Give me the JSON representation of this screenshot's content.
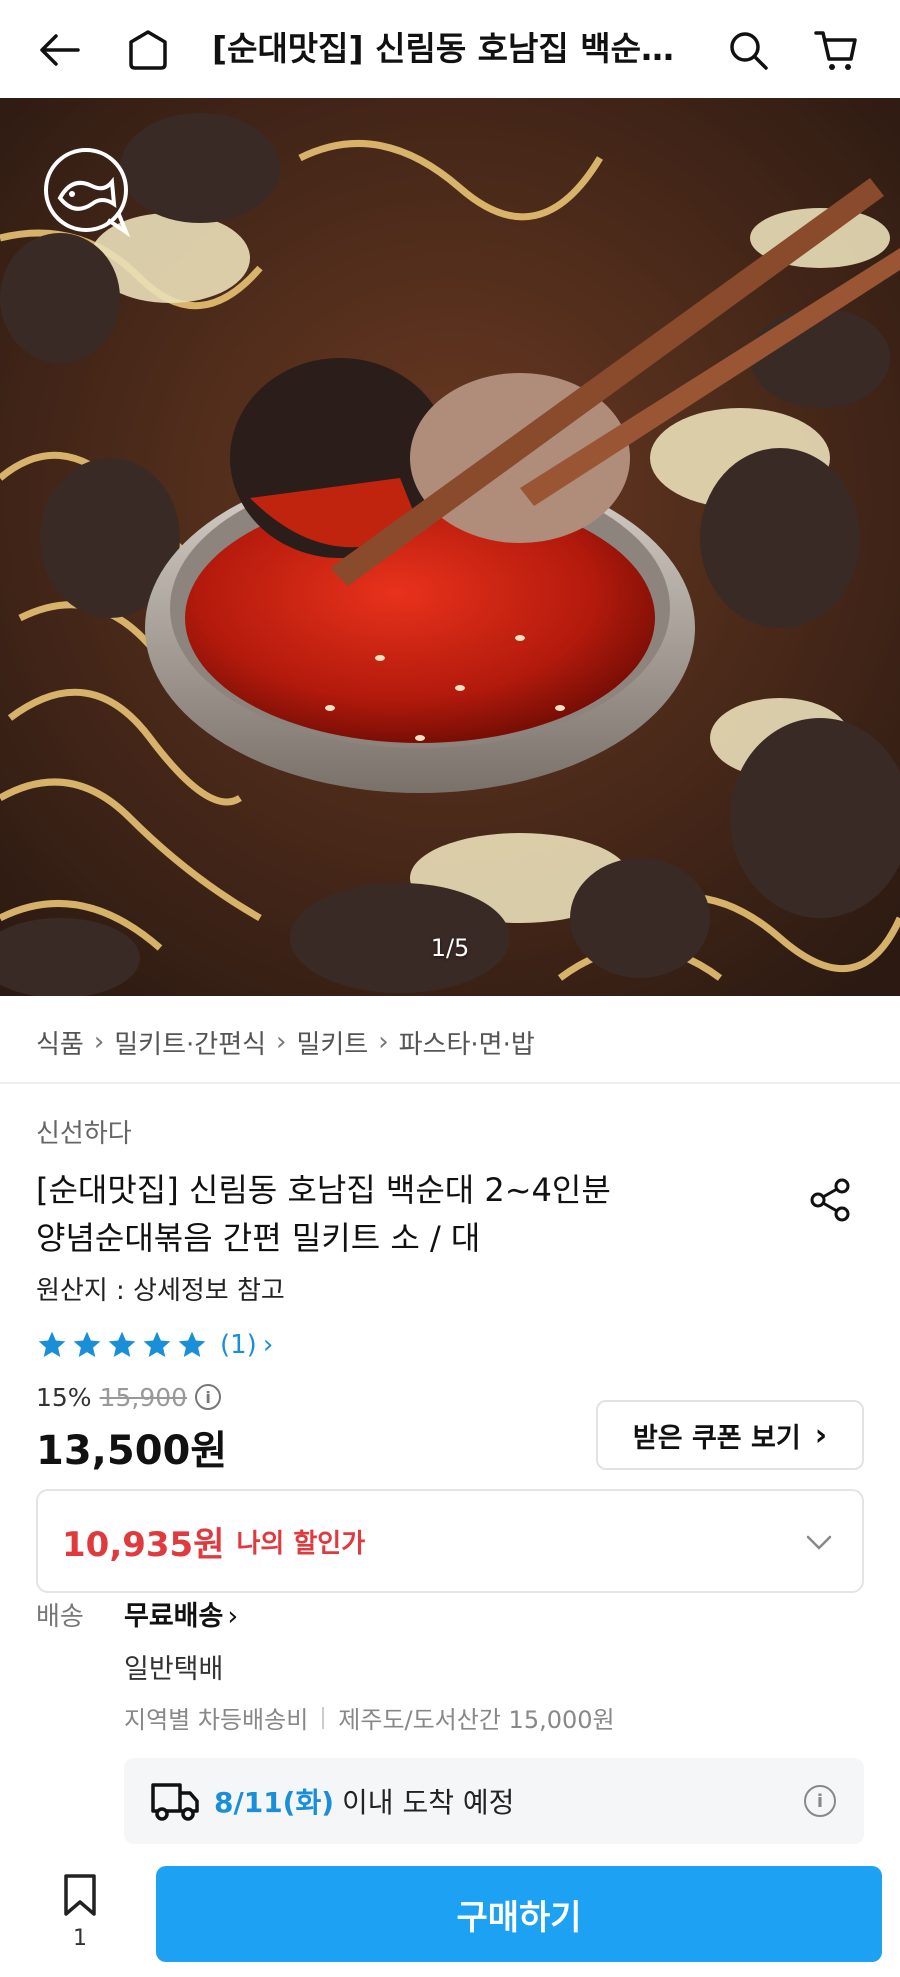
{
  "header": {
    "title": "[순대맛집] 신림동 호남집 백순…",
    "icons": [
      "back-arrow-icon",
      "home-icon",
      "search-icon",
      "cart-icon"
    ]
  },
  "hero": {
    "counter": "1/5",
    "logo": "fish-chat-logo-icon"
  },
  "breadcrumbs": [
    "식품",
    "밀키트·간편식",
    "밀키트",
    "파스타·면·밥"
  ],
  "product": {
    "brand": "신선하다",
    "title_line1": "[순대맛집] 신림동 호남집 백순대 2~4인분",
    "title_line2": "양념순대볶음 간편 밀키트 소 / 대",
    "origin": "원산지 : 상세정보 참고",
    "rating_stars": 5,
    "review_count": "(1)",
    "discount_pct": "15%",
    "original_price": "15,900",
    "price": "13,500원"
  },
  "coupon": {
    "label": "받은 쿠폰 보기",
    "arrow": "›"
  },
  "my_price": {
    "amount": "10,935원",
    "label": "나의 할인가"
  },
  "shipping": {
    "label": "배송",
    "free": "무료배송",
    "type": "일반택배",
    "fee_left": "지역별 차등배송비",
    "fee_right": "제주도/도서산간 15,000원",
    "arrival_date": "8/11(화)",
    "arrival_text": "이내 도착 예정"
  },
  "bottom_bar": {
    "bookmark_count": "1",
    "buy_label": "구매하기"
  },
  "colors": {
    "accent_blue": "#1da1f2",
    "link_blue": "#1a8fd8",
    "discount_red": "#e03a3e",
    "star_blue": "#1a8fd8"
  }
}
